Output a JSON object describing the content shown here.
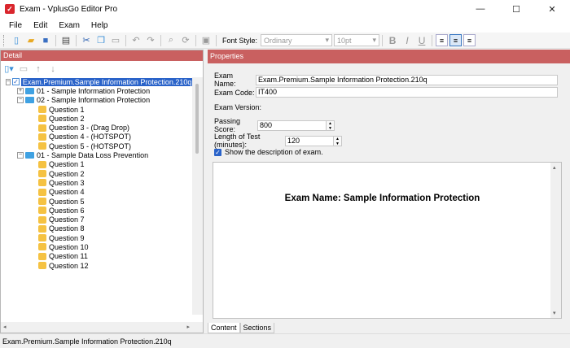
{
  "window": {
    "title": "Exam - VplusGo Editor Pro",
    "minimize": "—",
    "maximize": "☐",
    "close": "✕"
  },
  "menu": [
    "File",
    "Edit",
    "Exam",
    "Help"
  ],
  "toolbar": {
    "font_style_label": "Font Style:",
    "font_style_value": "Ordinary",
    "font_size_value": "10pt",
    "bold": "B",
    "italic": "I",
    "underline": "U"
  },
  "left_panel": {
    "header": "Detail",
    "tree": {
      "root": "Exam.Premium.Sample Information Protection.210q",
      "sections": [
        {
          "label": "01 - Sample Information Protection",
          "expanded": false,
          "questions": []
        },
        {
          "label": "02 - Sample Information Protection",
          "expanded": true,
          "questions": [
            "Question 1",
            "Question 2",
            "Question 3 - (Drag Drop)",
            "Question 4 - (HOTSPOT)",
            "Question 5 - (HOTSPOT)"
          ]
        },
        {
          "label": "01 - Sample Data Loss Prevention",
          "expanded": true,
          "questions": [
            "Question 1",
            "Question 2",
            "Question 3",
            "Question 4",
            "Question 5",
            "Question 6",
            "Question 7",
            "Question 8",
            "Question 9",
            "Question 10",
            "Question 11",
            "Question 12"
          ]
        }
      ]
    }
  },
  "properties": {
    "header": "Properties",
    "exam_name_label": "Exam Name:",
    "exam_name_value": "Exam.Premium.Sample Information Protection.210q",
    "exam_code_label": "Exam Code:",
    "exam_code_value": "IT400",
    "exam_version_label": "Exam Version:",
    "passing_score_label": "Passing Score:",
    "passing_score_value": "800",
    "length_label": "Length of Test (minutes):",
    "length_value": "120",
    "show_description_label": "Show the description of exam.",
    "show_description_checked": true,
    "content_heading": "Exam Name:  Sample Information Protection",
    "tabs": [
      "Content",
      "Sections"
    ],
    "active_tab": "Content"
  },
  "status_bar": {
    "text": "Exam.Premium.Sample Information Protection.210q"
  },
  "colors": {
    "panel_header": "#c96060",
    "selection": "#2a63c9",
    "section_icon": "#3fa1e2",
    "question_icon": "#f5c242"
  }
}
